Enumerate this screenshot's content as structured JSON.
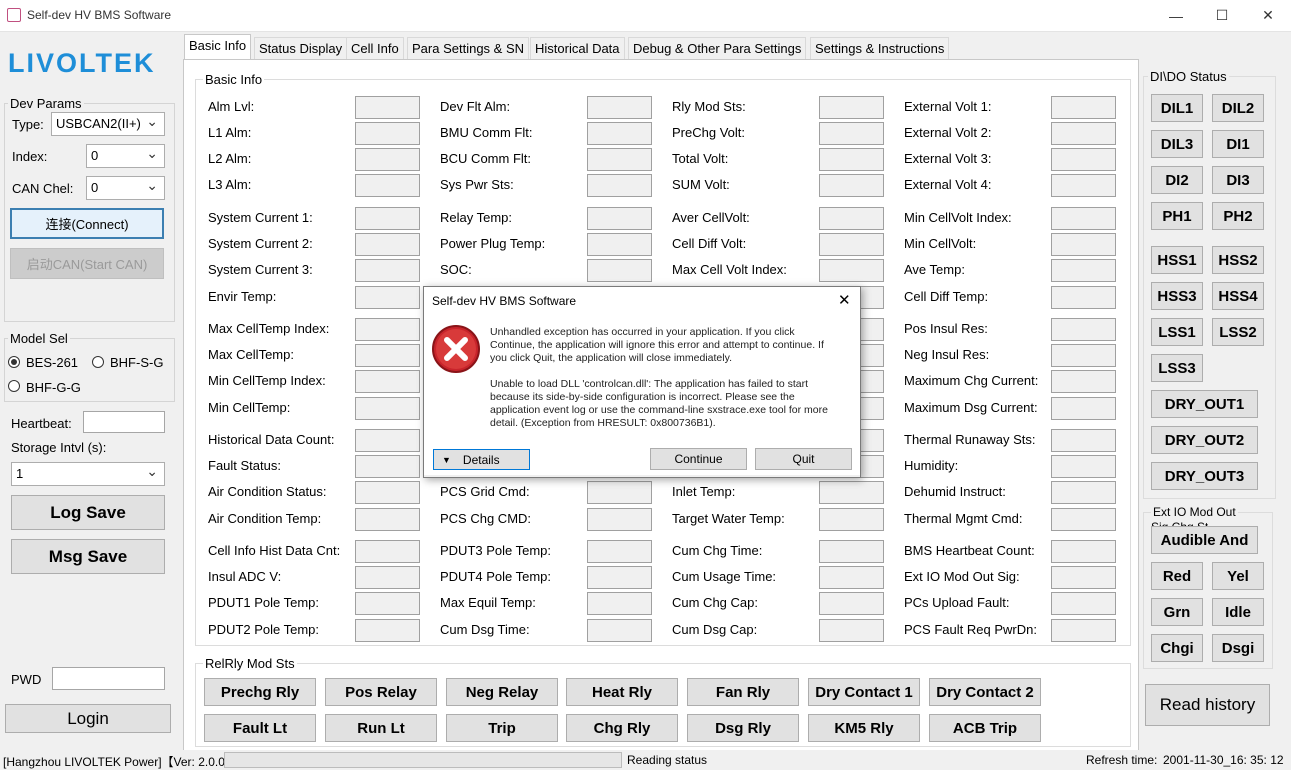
{
  "window": {
    "title": "Self-dev HV BMS Software",
    "minimize": "—",
    "maximize": "☐",
    "close": "✕"
  },
  "logo": "LIVOLTEK",
  "dev_params": {
    "title": "Dev Params",
    "type_label": "Type:",
    "type_value": "USBCAN2(II+)",
    "index_label": "Index:",
    "index_value": "0",
    "can_label": "CAN Chel:",
    "can_value": "0",
    "connect": "连接(Connect)",
    "start_can": "启动CAN(Start CAN)"
  },
  "model_sel": {
    "title": "Model Sel",
    "opt1": "BES-261",
    "opt2": "BHF-S-G",
    "opt3": "BHF-G-G"
  },
  "heartbeat_label": "Heartbeat:",
  "storage_label": "Storage Intvl (s):",
  "storage_value": "1",
  "log_save": "Log Save",
  "msg_save": "Msg Save",
  "pwd_label": "PWD",
  "login": "Login",
  "tabs": [
    "Basic Info",
    "Status Display",
    "Cell Info",
    "Para Settings & SN",
    "Historical Data",
    "Debug & Other Para Settings",
    "Settings & Instructions"
  ],
  "basic_info_title": "Basic Info",
  "col1": [
    "Alm Lvl:",
    "L1 Alm:",
    "L2 Alm:",
    "L3 Alm:",
    "System Current 1:",
    "System Current 2:",
    "System Current 3:",
    "Envir Temp:",
    "Max CellTemp Index:",
    "Max CellTemp:",
    "Min CellTemp Index:",
    "Min CellTemp:",
    "Historical Data Count:",
    "Fault Status:",
    "Air Condition Status:",
    "Air Condition Temp:",
    "Cell Info Hist Data Cnt:",
    "Insul ADC V:",
    "PDUT1 Pole Temp:",
    "PDUT2 Pole Temp:"
  ],
  "col2": [
    "Dev Flt Alm:",
    "BMU Comm Flt:",
    "BCU Comm Flt:",
    "Sys Pwr Sts:",
    "Relay Temp:",
    "Power Plug Temp:",
    "SOC:",
    "",
    "",
    "",
    "",
    "",
    "",
    "",
    "PCS Grid Cmd:",
    "PCS Chg CMD:",
    "PDUT3 Pole Temp:",
    "PDUT4 Pole Temp:",
    "Max Equil Temp:",
    "Cum Dsg Time:"
  ],
  "col3": [
    "Rly Mod Sts:",
    "PreChg Volt:",
    "Total Volt:",
    "SUM Volt:",
    "Aver CellVolt:",
    "Cell Diff Volt:",
    "Max Cell Volt Index:",
    "",
    "",
    "",
    "",
    "",
    "",
    "",
    "Inlet Temp:",
    "Target Water Temp:",
    "Cum Chg Time:",
    "Cum Usage Time:",
    "Cum Chg Cap:",
    "Cum Dsg Cap:"
  ],
  "col4": [
    "External Volt 1:",
    "External Volt 2:",
    "External Volt 3:",
    "External Volt 4:",
    "Min CellVolt Index:",
    "Min CellVolt:",
    "Ave Temp:",
    "Cell Diff Temp:",
    "Pos Insul Res:",
    "Neg Insul Res:",
    "Maximum Chg Current:",
    "Maximum Dsg Current:",
    "Thermal Runaway Sts:",
    "Humidity:",
    "Dehumid Instruct:",
    "Thermal Mgmt Cmd:",
    "BMS Heartbeat Count:",
    "Ext IO Mod Out Sig:",
    "PCs Upload Fault:",
    "PCS Fault Req PwrDn:"
  ],
  "relrly": {
    "title": "RelRly Mod Sts",
    "row1": [
      "Prechg Rly",
      "Pos Relay",
      "Neg Relay",
      "Heat Rly",
      "Fan Rly",
      "Dry Contact 1",
      "Dry Contact 2"
    ],
    "row2": [
      "Fault Lt",
      "Run Lt",
      "Trip",
      "Chg Rly",
      "Dsg Rly",
      "KM5 Rly",
      "ACB Trip"
    ]
  },
  "dido": {
    "title": "DI\\DO Status",
    "pairs": [
      [
        "DIL1",
        "DIL2"
      ],
      [
        "DIL3",
        "DI1"
      ],
      [
        "DI2",
        "DI3"
      ],
      [
        "PH1",
        "PH2"
      ],
      [
        "HSS1",
        "HSS2"
      ],
      [
        "HSS3",
        "HSS4"
      ],
      [
        "LSS1",
        "LSS2"
      ]
    ],
    "lss3": "LSS3",
    "dry": [
      "DRY_OUT1",
      "DRY_OUT2",
      "DRY_OUT3"
    ]
  },
  "extio": {
    "title": "Ext IO Mod Out",
    "sub": "Sig Chg St",
    "audible": "Audible And",
    "pairs": [
      [
        "Red",
        "Yel"
      ],
      [
        "Grn",
        "Idle"
      ],
      [
        "Chgi",
        "Dsgi"
      ]
    ]
  },
  "read_history": "Read history",
  "dialog": {
    "title": "Self-dev HV BMS Software",
    "msg1": "Unhandled exception has occurred in your application. If you click Continue, the application will ignore this error and attempt to continue. If you click Quit, the application will close immediately.",
    "msg2": "Unable to load DLL 'controlcan.dll': The application has failed to start because its side-by-side configuration is incorrect. Please see the application event log or use the command-line sxstrace.exe tool for more detail. (Exception from HRESULT: 0x800736B1).",
    "details": "Details",
    "continue": "Continue",
    "quit": "Quit"
  },
  "status": {
    "company": "[Hangzhou LIVOLTEK Power]【Ver: 2.0.0】",
    "reading": "Reading status",
    "refresh_label": "Refresh time:",
    "refresh_value": "2001-11-30_16: 35: 12"
  }
}
